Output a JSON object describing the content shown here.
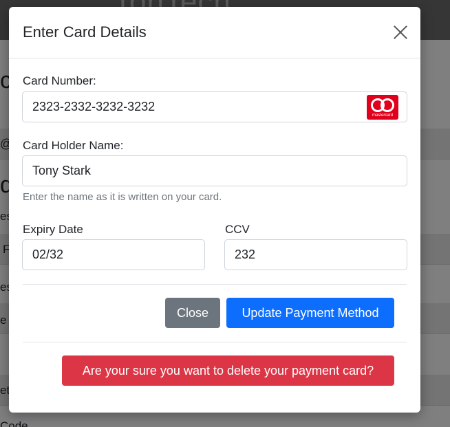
{
  "background": {
    "brand": "TonTech",
    "fragments": [
      "co",
      "@",
      "d",
      "ess",
      "F",
      "ess",
      "e",
      "et",
      "Code"
    ]
  },
  "modal": {
    "title": "Enter Card Details",
    "card_number": {
      "label": "Card Number:",
      "value": "2323-2332-3232-3232",
      "brand_icon": "mastercard-icon",
      "brand_text": "mastercard"
    },
    "holder": {
      "label": "Card Holder Name:",
      "value": "Tony Stark",
      "help": "Enter the name as it is written on your card."
    },
    "expiry": {
      "label": "Expiry Date",
      "value": "02/32"
    },
    "ccv": {
      "label": "CCV",
      "value": "232"
    },
    "buttons": {
      "close": "Close",
      "update": "Update Payment Method",
      "delete": "Are your sure you want to delete your payment card?"
    }
  },
  "colors": {
    "primary": "#0d6efd",
    "secondary": "#6c757d",
    "danger": "#dc3545",
    "mastercard": "#e0001b"
  }
}
